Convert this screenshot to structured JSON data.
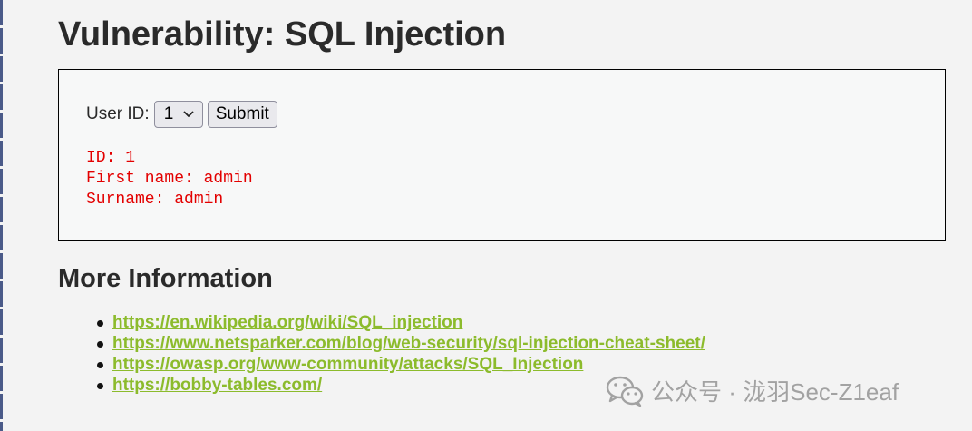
{
  "page": {
    "title": "Vulnerability: SQL Injection"
  },
  "form": {
    "label": "User ID:",
    "select_value": "1",
    "submit_label": "Submit"
  },
  "result": {
    "id_line": "ID: 1",
    "first_name_line": "First name: admin",
    "surname_line": "Surname: admin"
  },
  "more_info": {
    "title": "More Information",
    "links": [
      "https://en.wikipedia.org/wiki/SQL_injection",
      "https://www.netsparker.com/blog/web-security/sql-injection-cheat-sheet/",
      "https://owasp.org/www-community/attacks/SQL_Injection",
      "https://bobby-tables.com/"
    ]
  },
  "watermark": {
    "text": "公众号 · 泷羽Sec-Z1eaf",
    "icon": "wechat-icon"
  },
  "colors": {
    "background": "#f3f3f3",
    "result_text": "#e30000",
    "link": "#8cbb2c",
    "heading": "#2a2a2a"
  }
}
